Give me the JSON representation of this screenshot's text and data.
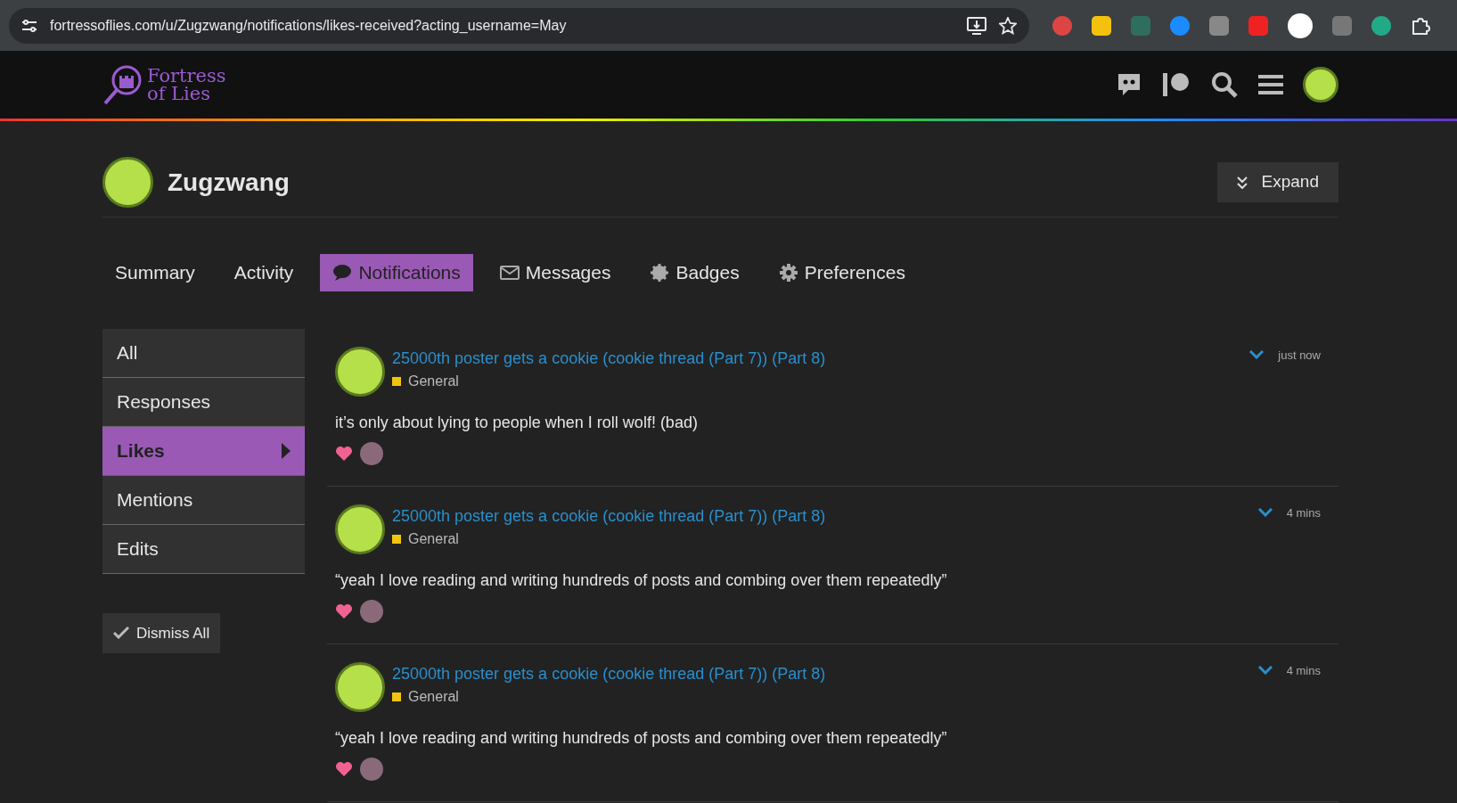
{
  "browser": {
    "url": "fortressoflies.com/u/Zugzwang/notifications/likes-received?acting_username=May"
  },
  "site": {
    "logo_lines": [
      "Fortress",
      "of Lies"
    ]
  },
  "user": {
    "name": "Zugzwang",
    "expand_label": "Expand"
  },
  "tabs": [
    {
      "label": "Summary",
      "selected": false
    },
    {
      "label": "Activity",
      "selected": false
    },
    {
      "label": "Notifications",
      "selected": true
    },
    {
      "label": "Messages",
      "selected": false
    },
    {
      "label": "Badges",
      "selected": false
    },
    {
      "label": "Preferences",
      "selected": false
    }
  ],
  "sidebar": {
    "items": [
      {
        "label": "All",
        "selected": false
      },
      {
        "label": "Responses",
        "selected": false
      },
      {
        "label": "Likes",
        "selected": true
      },
      {
        "label": "Mentions",
        "selected": false
      },
      {
        "label": "Edits",
        "selected": false
      }
    ],
    "dismiss_label": "Dismiss All"
  },
  "notifications": [
    {
      "title": "25000th poster gets a cookie (cookie thread (Part 7)) (Part 8)",
      "category": {
        "name": "General",
        "color": "#f1c40f"
      },
      "time": "just now",
      "excerpt": "it’s only about lying to people when I roll wolf! (bad)"
    },
    {
      "title": "25000th poster gets a cookie (cookie thread (Part 7)) (Part 8)",
      "category": {
        "name": "General",
        "color": "#f1c40f"
      },
      "time": "4 mins",
      "excerpt": "“yeah I love reading and writing hundreds of posts and combing over them repeatedly”"
    },
    {
      "title": "25000th poster gets a cookie (cookie thread (Part 7)) (Part 8)",
      "category": {
        "name": "General",
        "color": "#f1c40f"
      },
      "time": "4 mins",
      "excerpt": "“yeah I love reading and writing hundreds of posts and combing over them repeatedly”"
    }
  ]
}
